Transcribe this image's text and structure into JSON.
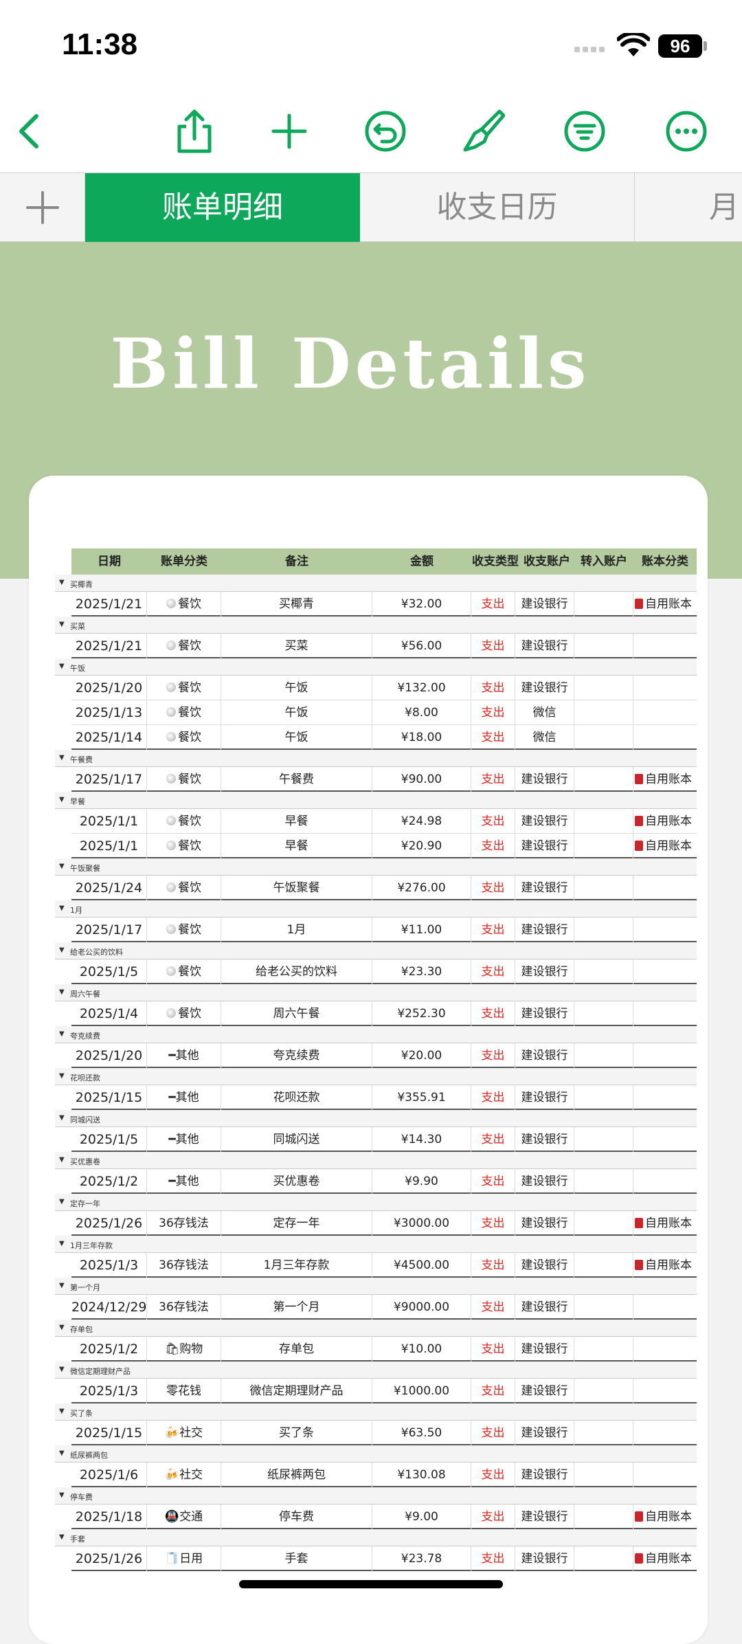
{
  "status": {
    "time": "11:38",
    "battery": "96"
  },
  "toolbar": {
    "back": "back-icon",
    "share": "share-icon",
    "add": "plus-icon",
    "undo": "undo-icon",
    "format": "paintbrush-icon",
    "filter": "filter-icon",
    "more": "more-icon"
  },
  "tabs": [
    {
      "label": "账单明细",
      "active": true
    },
    {
      "label": "收支日历",
      "active": false
    },
    {
      "label": "月",
      "active": false
    }
  ],
  "banner": {
    "title": "Bill Details"
  },
  "colors": {
    "accent": "#0da85a",
    "banner": "#b3cb9e",
    "expense": "#e0271f",
    "book": "#c8262c"
  },
  "headers": [
    "日期",
    "账单分类",
    "备注",
    "金额",
    "收支类型",
    "收支账户",
    "转入账户",
    "账本分类"
  ],
  "groups": [
    {
      "label": "买椰青",
      "rows": [
        [
          "2025/1/21",
          "餐饮",
          "买椰青",
          "¥32.00",
          "支出",
          "建设银行",
          "",
          "自用账本"
        ]
      ]
    },
    {
      "label": "买菜",
      "rows": [
        [
          "2025/1/21",
          "餐饮",
          "买菜",
          "¥56.00",
          "支出",
          "建设银行",
          "",
          ""
        ]
      ]
    },
    {
      "label": "午饭",
      "rows": [
        [
          "2025/1/20",
          "餐饮",
          "午饭",
          "¥132.00",
          "支出",
          "建设银行",
          "",
          ""
        ],
        [
          "2025/1/13",
          "餐饮",
          "午饭",
          "¥8.00",
          "支出",
          "微信",
          "",
          ""
        ],
        [
          "2025/1/14",
          "餐饮",
          "午饭",
          "¥18.00",
          "支出",
          "微信",
          "",
          ""
        ]
      ]
    },
    {
      "label": "午餐费",
      "rows": [
        [
          "2025/1/17",
          "餐饮",
          "午餐费",
          "¥90.00",
          "支出",
          "建设银行",
          "",
          "自用账本"
        ]
      ]
    },
    {
      "label": "早餐",
      "rows": [
        [
          "2025/1/1",
          "餐饮",
          "早餐",
          "¥24.98",
          "支出",
          "建设银行",
          "",
          "自用账本"
        ],
        [
          "2025/1/1",
          "餐饮",
          "早餐",
          "¥20.90",
          "支出",
          "建设银行",
          "",
          "自用账本"
        ]
      ]
    },
    {
      "label": "午饭聚餐",
      "rows": [
        [
          "2025/1/24",
          "餐饮",
          "午饭聚餐",
          "¥276.00",
          "支出",
          "建设银行",
          "",
          ""
        ]
      ]
    },
    {
      "label": "1月",
      "rows": [
        [
          "2025/1/17",
          "餐饮",
          "1月",
          "¥11.00",
          "支出",
          "建设银行",
          "",
          ""
        ]
      ]
    },
    {
      "label": "给老公买的饮料",
      "rows": [
        [
          "2025/1/5",
          "餐饮",
          "给老公买的饮料",
          "¥23.30",
          "支出",
          "建设银行",
          "",
          ""
        ]
      ]
    },
    {
      "label": "周六午餐",
      "rows": [
        [
          "2025/1/4",
          "餐饮",
          "周六午餐",
          "¥252.30",
          "支出",
          "建设银行",
          "",
          ""
        ]
      ]
    },
    {
      "label": "夸克续费",
      "rows": [
        [
          "2025/1/20",
          "━其他",
          "夸克续费",
          "¥20.00",
          "支出",
          "建设银行",
          "",
          ""
        ]
      ]
    },
    {
      "label": "花呗还款",
      "rows": [
        [
          "2025/1/15",
          "━其他",
          "花呗还款",
          "¥355.91",
          "支出",
          "建设银行",
          "",
          ""
        ]
      ]
    },
    {
      "label": "同城闪送",
      "rows": [
        [
          "2025/1/5",
          "━其他",
          "同城闪送",
          "¥14.30",
          "支出",
          "建设银行",
          "",
          ""
        ]
      ]
    },
    {
      "label": "买优惠卷",
      "rows": [
        [
          "2025/1/2",
          "━其他",
          "买优惠卷",
          "¥9.90",
          "支出",
          "建设银行",
          "",
          ""
        ]
      ]
    },
    {
      "label": "定存一年",
      "rows": [
        [
          "2025/1/26",
          "36存钱法",
          "定存一年",
          "¥3000.00",
          "支出",
          "建设银行",
          "",
          "自用账本"
        ]
      ]
    },
    {
      "label": "1月三年存款",
      "rows": [
        [
          "2025/1/3",
          "36存钱法",
          "1月三年存款",
          "¥4500.00",
          "支出",
          "建设银行",
          "",
          "自用账本"
        ]
      ]
    },
    {
      "label": "第一个月",
      "rows": [
        [
          "2024/12/29",
          "36存钱法",
          "第一个月",
          "¥9000.00",
          "支出",
          "建设银行",
          "",
          ""
        ]
      ]
    },
    {
      "label": "存单包",
      "rows": [
        [
          "2025/1/2",
          "🛍购物",
          "存单包",
          "¥10.00",
          "支出",
          "建设银行",
          "",
          ""
        ]
      ]
    },
    {
      "label": "微信定期理财产品",
      "rows": [
        [
          "2025/1/3",
          "零花钱",
          "微信定期理财产品",
          "¥1000.00",
          "支出",
          "建设银行",
          "",
          ""
        ]
      ]
    },
    {
      "label": "买了条",
      "rows": [
        [
          "2025/1/15",
          "🍻社交",
          "买了条",
          "¥63.50",
          "支出",
          "建设银行",
          "",
          ""
        ]
      ]
    },
    {
      "label": "纸尿裤两包",
      "rows": [
        [
          "2025/1/6",
          "🍻社交",
          "纸尿裤两包",
          "¥130.08",
          "支出",
          "建设银行",
          "",
          ""
        ]
      ]
    },
    {
      "label": "停车费",
      "rows": [
        [
          "2025/1/18",
          "🚇交通",
          "停车费",
          "¥9.00",
          "支出",
          "建设银行",
          "",
          "自用账本"
        ]
      ]
    },
    {
      "label": "手套",
      "rows": [
        [
          "2025/1/26",
          "🧻日用",
          "手套",
          "¥23.78",
          "支出",
          "建设银行",
          "",
          "自用账本"
        ]
      ]
    }
  ]
}
